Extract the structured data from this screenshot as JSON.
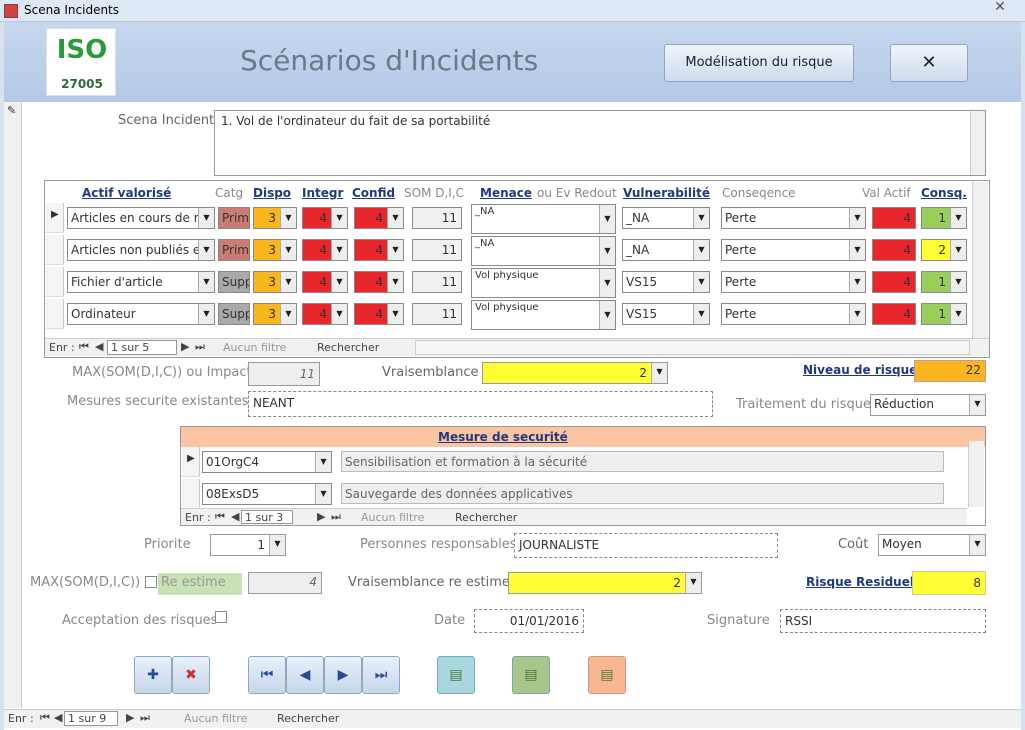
{
  "window": {
    "title": "Scena Incidents",
    "close": "✕"
  },
  "header": {
    "logo_text": "ISO",
    "logo_number": "27005",
    "title": "Scénarios d'Incidents",
    "model_button": "Modélisation du risque",
    "close_button": "✕"
  },
  "scena": {
    "label": "Scena Incident",
    "value": "1. Vol de l'ordinateur du fait de sa portabilité"
  },
  "assets": {
    "headers": {
      "actif": "Actif valorisé",
      "catg": "Catg",
      "dispo": "Dispo",
      "integr": "Integr",
      "confid": "Confid",
      "som": "SOM D,I,C",
      "menace": "Menace",
      "ev": "ou Ev Redout",
      "vuln": "Vulnerabilité",
      "consequence": "Conseqence",
      "valactif": "Val Actif",
      "consq": "Consq."
    },
    "rows": [
      {
        "actif": "Articles en cours de réd",
        "catg": "Prim",
        "dispo": "3",
        "integr": "4",
        "confid": "4",
        "som": "11",
        "menace": "_NA",
        "vuln": "_NA",
        "consequence": "Perte",
        "valactif": "4",
        "consq": "1"
      },
      {
        "actif": "Articles non publiés et",
        "catg": "Prim",
        "dispo": "3",
        "integr": "4",
        "confid": "4",
        "som": "11",
        "menace": "_NA",
        "vuln": "_NA",
        "consequence": "Perte",
        "valactif": "4",
        "consq": "2"
      },
      {
        "actif": "Fichier d'article",
        "catg": "Supp",
        "dispo": "3",
        "integr": "4",
        "confid": "4",
        "som": "11",
        "menace": "Vol physique",
        "vuln": "VS15",
        "consequence": "Perte",
        "valactif": "4",
        "consq": "1"
      },
      {
        "actif": "Ordinateur",
        "catg": "Supp",
        "dispo": "3",
        "integr": "4",
        "confid": "4",
        "som": "11",
        "menace": "Vol physique",
        "vuln": "VS15",
        "consequence": "Perte",
        "valactif": "4",
        "consq": "1"
      }
    ],
    "nav": {
      "label": "Enr :",
      "position": "1 sur 5",
      "filter": "Aucun filtre",
      "search": "Rechercher"
    }
  },
  "risk": {
    "max_label": "MAX(SOM(D,I,C)) ou Impact",
    "max_value": "11",
    "vrais_label": "Vraisemblance",
    "vrais_value": "2",
    "niveau_label": "Niveau de risque",
    "niveau_value": "22",
    "mesures_label": "Mesures securite existantes",
    "mesures_value": "NEANT",
    "traitement_label": "Traitement du risque",
    "traitement_value": "Réduction"
  },
  "measures": {
    "header": "Mesure de securité",
    "rows": [
      {
        "code": "01OrgC4",
        "desc": "Sensibilisation et formation à la sécurité"
      },
      {
        "code": "08ExsD5",
        "desc": "Sauvegarde des données applicatives"
      }
    ],
    "nav": {
      "label": "Enr :",
      "position": "1 sur 3",
      "filter": "Aucun filtre",
      "search": "Rechercher"
    }
  },
  "plan": {
    "priorite_label": "Priorite",
    "priorite_value": "1",
    "responsables_label": "Personnes responsables",
    "responsables_value": "JOURNALISTE",
    "cout_label": "Coût",
    "cout_value": "Moyen",
    "max_label": "MAX(SOM(D,I,C))",
    "reestime_label": "Re estime",
    "max_value": "4",
    "vrais_label": "Vraisemblance re estime",
    "vrais_value": "2",
    "residuel_label": "Risque Residuel",
    "residuel_value": "8",
    "acceptation_label": "Acceptation des risques",
    "date_label": "Date",
    "date_value": "01/01/2016",
    "signature_label": "Signature",
    "signature_value": "RSSI"
  },
  "nav": {
    "label": "Enr :",
    "position": "1 sur 9",
    "filter": "Aucun filtre",
    "search": "Rechercher"
  },
  "colors": {
    "red": "#e8262b",
    "orange": "#fbb51f",
    "yellow": "#ffff33",
    "green": "#9acd5c",
    "salmon": "#c97c72",
    "gray": "#a9a9a9"
  }
}
